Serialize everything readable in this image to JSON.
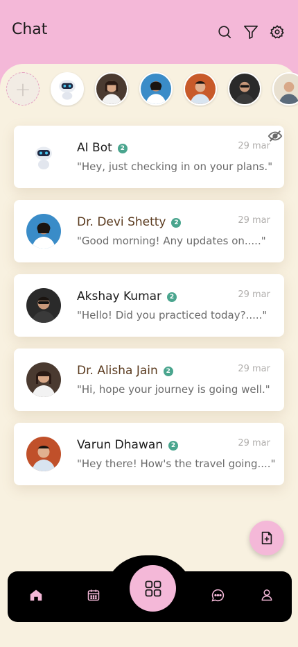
{
  "header": {
    "title": "Chat",
    "icons": [
      "search-icon",
      "filter-icon",
      "gear-icon"
    ]
  },
  "stories": [
    {
      "type": "add",
      "icon": "plus-icon"
    },
    {
      "type": "bot",
      "label": ""
    },
    {
      "type": "avatar",
      "color": "#6a4a3a"
    },
    {
      "type": "avatar",
      "color": "#3a7cbc"
    },
    {
      "type": "avatar",
      "color": "#c85a2a"
    },
    {
      "type": "avatar",
      "color": "#2a2a2a"
    },
    {
      "type": "avatar",
      "color": "#d8c8b0"
    }
  ],
  "chats": [
    {
      "name": "AI Bot",
      "badge": "2",
      "date": "29 mar",
      "message": "\"Hey, just checking in on your plans.\"",
      "doctor": false,
      "avatar": "bot",
      "hidden_icon": true
    },
    {
      "name": "Dr. Devi Shetty",
      "badge": "2",
      "date": "29 mar",
      "message": "\"Good morning! Any updates on.....\"",
      "doctor": true,
      "avatar": "#3a8cc8"
    },
    {
      "name": "Akshay Kumar",
      "badge": "2",
      "date": "29 mar",
      "message": "\"Hello! Did you practiced today?.....\"",
      "doctor": false,
      "avatar": "#2a2a2a"
    },
    {
      "name": "Dr. Alisha Jain",
      "badge": "2",
      "date": "29 mar",
      "message": "\"Hi, hope your journey is going well.\"",
      "doctor": true,
      "avatar": "#5a3a2a"
    },
    {
      "name": "Varun Dhawan",
      "badge": "2",
      "date": "29 mar",
      "message": "\"Hey there! How's the travel going....\"",
      "doctor": false,
      "avatar": "#c0502a"
    }
  ],
  "fab": {
    "icon": "new-note-icon"
  },
  "nav": {
    "items": [
      "home-icon",
      "calendar-icon",
      "grid-icon",
      "chat-bubble-icon",
      "profile-icon"
    ],
    "accent": "#f4b8d8"
  }
}
